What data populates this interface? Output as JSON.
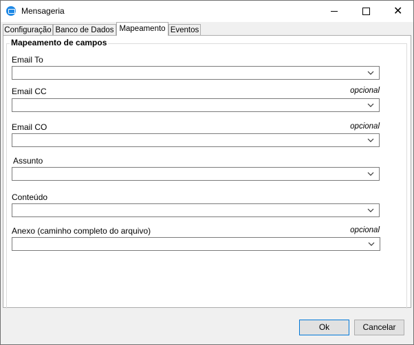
{
  "window": {
    "title": "Mensageria",
    "icon": "mail-app-icon"
  },
  "tabs": [
    {
      "label": "Configuração",
      "active": false
    },
    {
      "label": "Banco de Dados",
      "active": false
    },
    {
      "label": "Mapeamento",
      "active": true
    },
    {
      "label": "Eventos",
      "active": false
    }
  ],
  "group": {
    "title": "Mapeamento de campos"
  },
  "fields": [
    {
      "label": "Email To",
      "optional": "",
      "value": ""
    },
    {
      "label": "Email CC",
      "optional": "opcional",
      "value": ""
    },
    {
      "label": "Email CO",
      "optional": "opcional",
      "value": ""
    },
    {
      "label": "Assunto",
      "optional": "",
      "value": ""
    },
    {
      "label": "Conteúdo",
      "optional": "",
      "value": ""
    },
    {
      "label": "Anexo (caminho completo do arquivo)",
      "optional": "opcional",
      "value": ""
    }
  ],
  "buttons": {
    "ok": "Ok",
    "cancel": "Cancelar"
  },
  "controls": {
    "minimize": "minimize-icon",
    "maximize": "maximize-icon",
    "close": "close-icon"
  }
}
